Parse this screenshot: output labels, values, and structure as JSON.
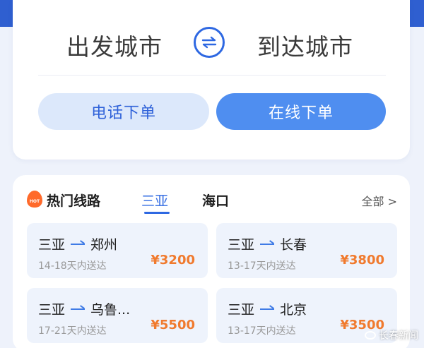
{
  "city_selector": {
    "from": "出发城市",
    "to": "到达城市",
    "swap_icon": "swap-arrows-icon"
  },
  "order_buttons": {
    "phone": "电话下单",
    "online": "在线下单"
  },
  "hot_routes": {
    "hot_icon_text": "HOT",
    "title": "热门线路",
    "tabs": [
      "三亚",
      "海口"
    ],
    "active_tab": "三亚",
    "view_all": "全部 >",
    "routes": [
      {
        "from": "三亚",
        "to": "郑州",
        "days": "14-18天内送达",
        "price": "¥3200"
      },
      {
        "from": "三亚",
        "to": "长春",
        "days": "13-17天内送达",
        "price": "¥3800"
      },
      {
        "from": "三亚",
        "to": "乌鲁...",
        "days": "17-21天内送达",
        "price": "¥5500"
      },
      {
        "from": "三亚",
        "to": "北京",
        "days": "13-17天内送达",
        "price": "¥3500"
      }
    ]
  },
  "watermark": "长春新闻",
  "colors": {
    "primary_blue": "#2e68e2",
    "online_button": "#4f8ef0",
    "phone_button_bg": "#dce8fb",
    "price_orange": "#f07a2e",
    "hot_orange": "#ff6a2b",
    "page_bg": "#eef2fb"
  }
}
